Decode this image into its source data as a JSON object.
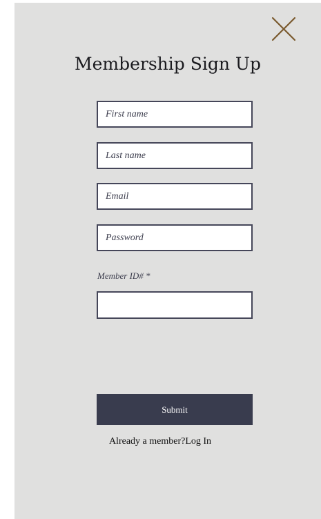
{
  "colors": {
    "panel_background": "#e0e0df",
    "field_border": "#454659",
    "submit_background": "#393c4e",
    "close_icon": "#7a5a2e"
  },
  "dialog": {
    "title": "Membership Sign Up",
    "close_icon": "close-icon"
  },
  "form": {
    "first_name_placeholder": "First name",
    "last_name_placeholder": "Last name",
    "email_placeholder": "Email",
    "password_placeholder": "Password",
    "member_id_label": "Member ID# *",
    "member_id_value": "",
    "submit_label": "Submit"
  },
  "footer": {
    "already_member_text": "Already a member?",
    "login_link": "Log In"
  }
}
